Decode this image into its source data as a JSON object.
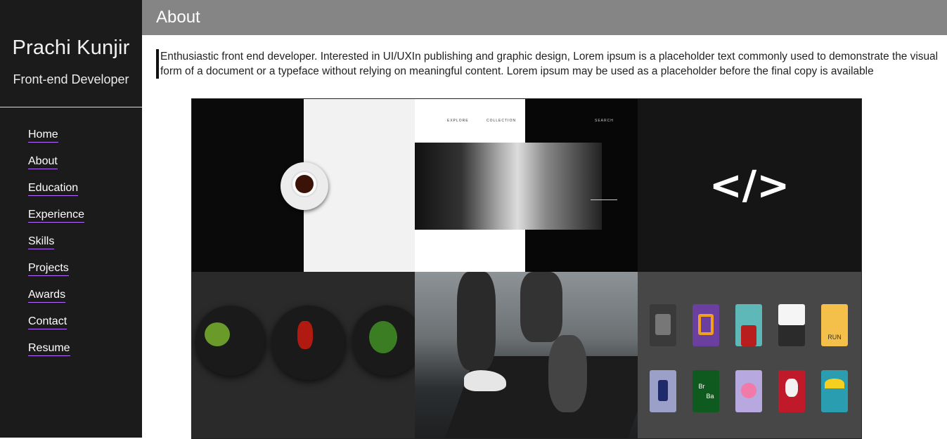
{
  "sidebar": {
    "name": "Prachi Kunjir",
    "role": "Front-end Developer",
    "nav": [
      "Home",
      "About",
      "Education",
      "Experience",
      "Skills",
      "Projects",
      "Awards",
      "Contact",
      "Resume"
    ]
  },
  "header": {
    "title": "About"
  },
  "intro": {
    "text": "Enthusiastic front end developer. Interested in UI/UXIn publishing and graphic design, Lorem ipsum is a placeholder text commonly used to demonstrate the visual form of a document or a typeface without relying on meaningful content. Lorem ipsum may be used as a placeholder before the final copy is available"
  },
  "gallery": {
    "tiles": [
      "coffee-cup-photo",
      "fashion-website-mockup",
      "code-symbol-graphic",
      "food-plates-photo",
      "treadmill-running-photo",
      "tv-show-icons-grid"
    ],
    "mockup_menu": [
      "EXPLORE",
      "COLLECTION",
      "SEARCH"
    ],
    "code_symbol": "</>",
    "card_labels": [
      "RUN",
      "Br",
      "Ba"
    ],
    "card_colors": [
      "#3a3a3a",
      "#6b3fa0",
      "#5fb8b8",
      "#2b2b2b",
      "#f5c04a",
      "#9aa0c8",
      "#0f5a1e",
      "#b7a8e0",
      "#c01a2a",
      "#2a9db0"
    ]
  }
}
